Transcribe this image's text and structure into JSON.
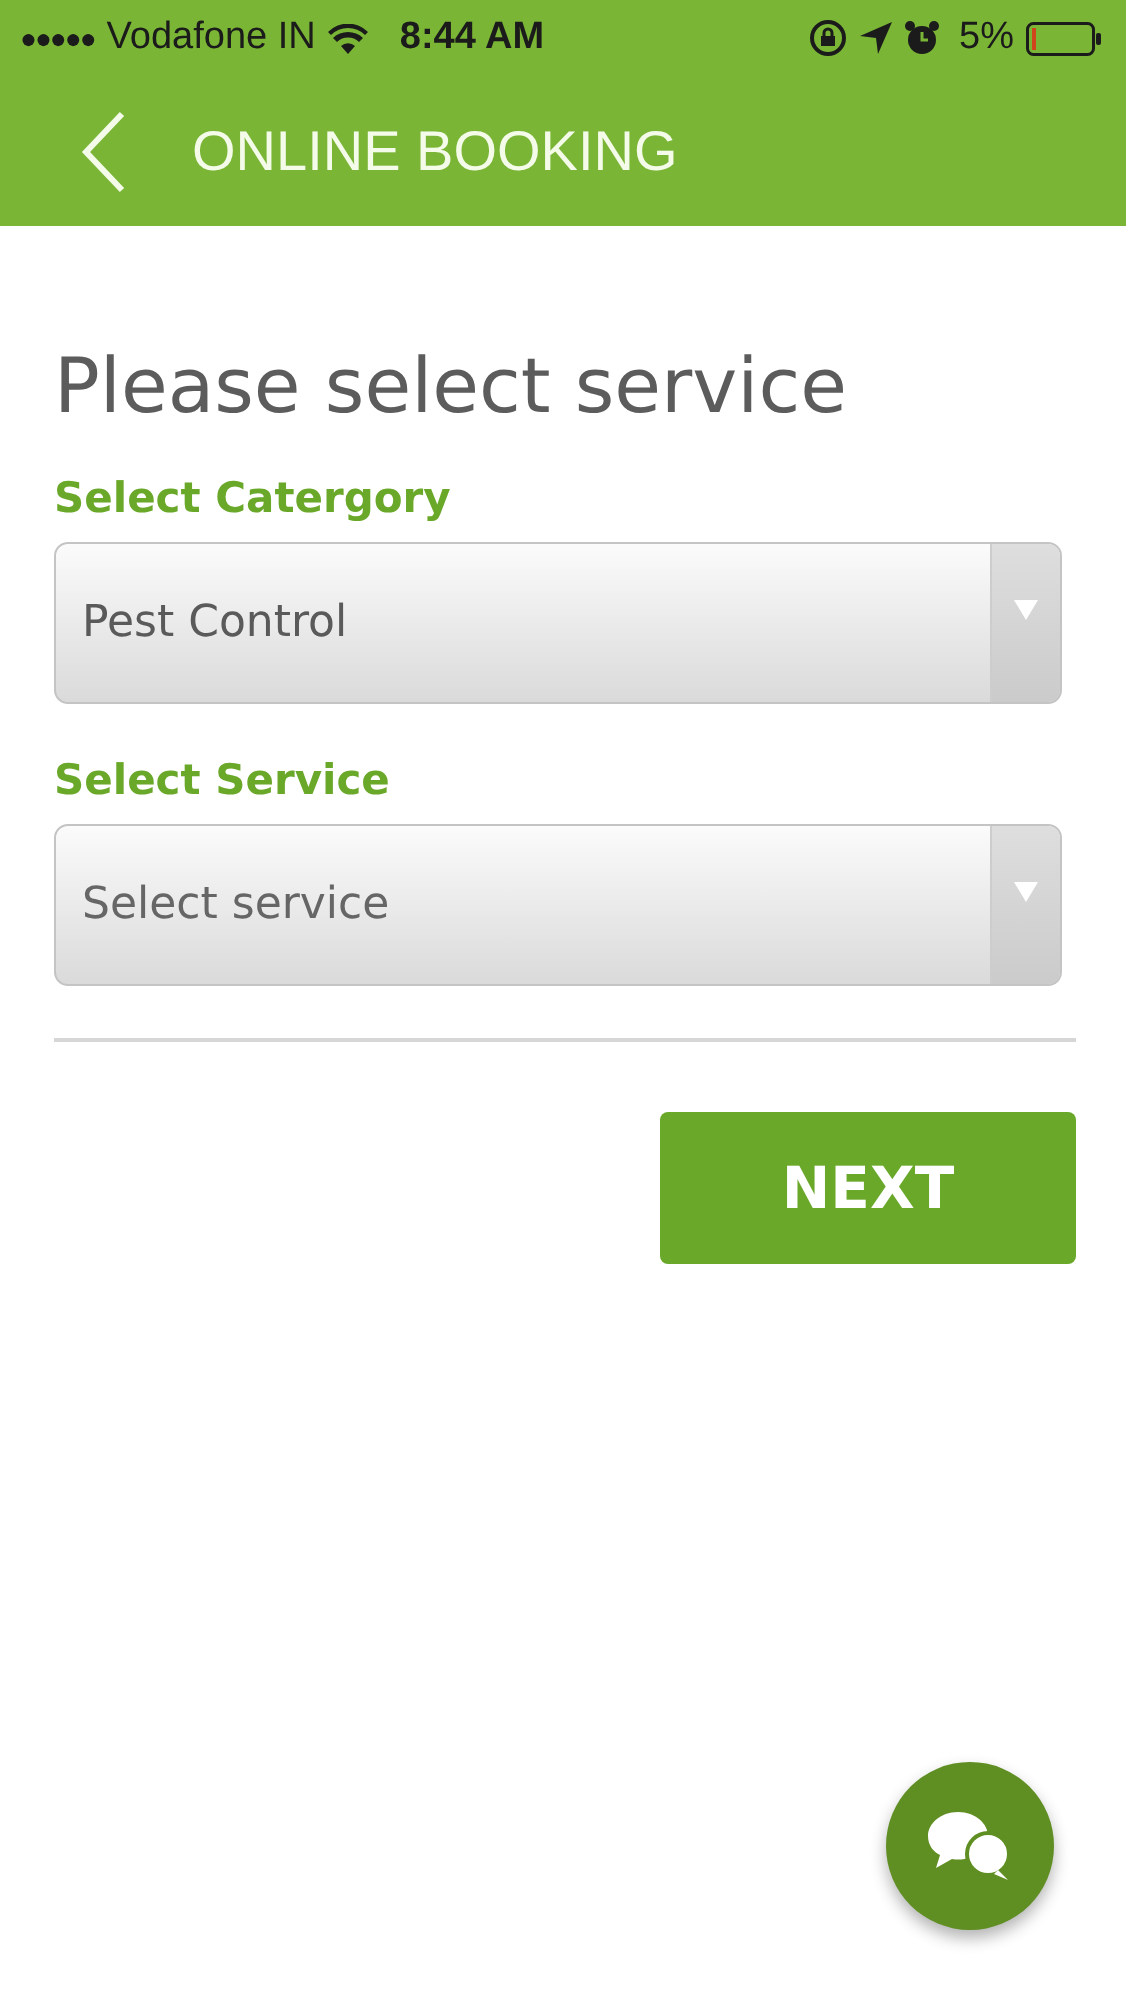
{
  "status_bar": {
    "signal": "●●●●●",
    "carrier": "Vodafone IN",
    "time": "8:44 AM",
    "battery": "5%"
  },
  "header": {
    "title": "ONLINE BOOKING"
  },
  "heading": "Please select service",
  "fields": [
    {
      "label": "Select Catergory",
      "value": "Pest Control"
    },
    {
      "label": "Select Service",
      "placeholder": "Select service"
    }
  ],
  "next_button": "NEXT"
}
